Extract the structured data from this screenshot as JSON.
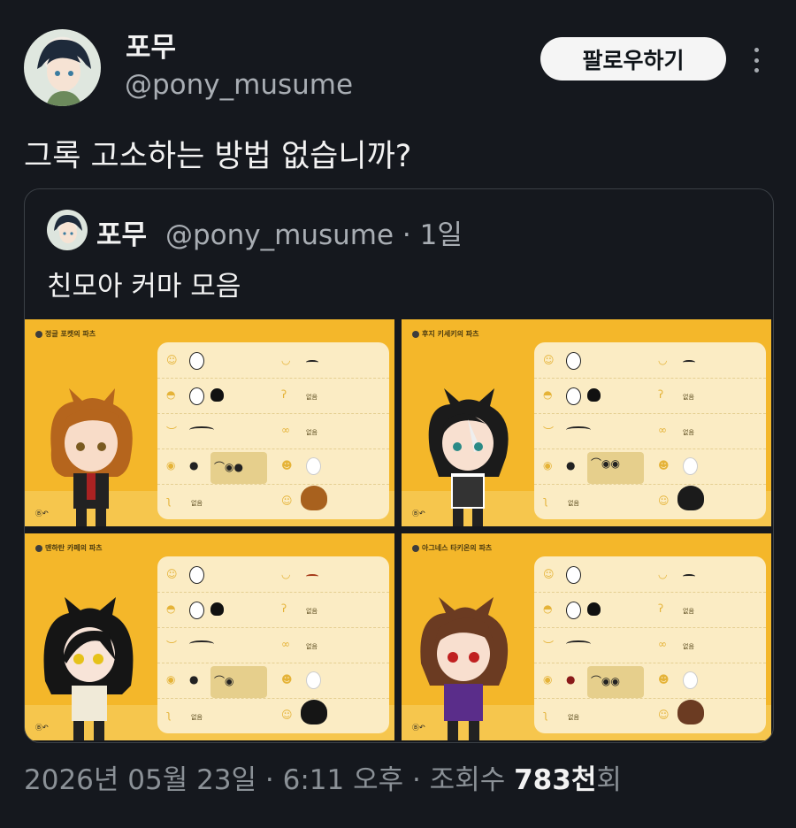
{
  "author": {
    "name": "포무",
    "handle": "@pony_musume"
  },
  "follow_label": "팔로우하기",
  "tweet_text": "그록 고소하는 방법 없습니까?",
  "quoted": {
    "name": "포무",
    "meta": "@pony_musume · 1일",
    "text": "친모아 커마 모음",
    "panels": [
      {
        "title": "정글 포켓의 파츠",
        "none_labels": [
          "없음",
          "없음",
          "없음"
        ]
      },
      {
        "title": "후지 키세키의 파츠",
        "none_labels": [
          "없음",
          "없음",
          "없음"
        ]
      },
      {
        "title": "맨하탄 카페의 파츠",
        "none_labels": [
          "없음",
          "없음",
          "없음"
        ]
      },
      {
        "title": "아그네스 타키온의 파츠",
        "none_labels": [
          "없음",
          "없음",
          "없음"
        ]
      }
    ]
  },
  "footer": {
    "date": "2026년 05월 23일 · 6:11 오후 · 조회수 ",
    "views": "783천",
    "suffix": "회"
  },
  "colors": {
    "background": "#15181e",
    "panel": "#f4b72a",
    "card": "#fbecc4"
  }
}
